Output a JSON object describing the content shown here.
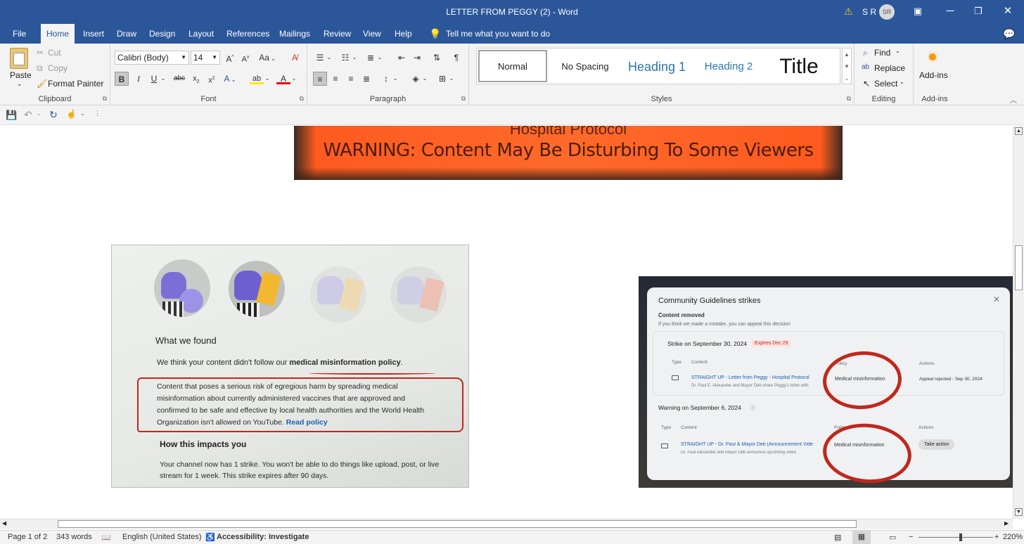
{
  "window": {
    "title": "LETTER FROM PEGGY (2)  -  Word",
    "user_initials": "S R",
    "avatar": "SR"
  },
  "menu": {
    "tabs": [
      "File",
      "Home",
      "Insert",
      "Draw",
      "Design",
      "Layout",
      "References",
      "Mailings",
      "Review",
      "View",
      "Help"
    ],
    "tell_me": "Tell me what you want to do"
  },
  "clipboard": {
    "paste": "Paste",
    "cut": "Cut",
    "copy": "Copy",
    "format_painter": "Format Painter",
    "label": "Clipboard"
  },
  "font": {
    "name": "Calibri (Body)",
    "size": "14",
    "label": "Font",
    "case_btn": "Aa"
  },
  "paragraph": {
    "label": "Paragraph"
  },
  "styles": {
    "items": [
      "Normal",
      "No Spacing",
      "Heading 1",
      "Heading 2",
      "Title"
    ],
    "label": "Styles"
  },
  "editing": {
    "find": "Find",
    "replace": "Replace",
    "select": "Select",
    "label": "Editing"
  },
  "addins": {
    "button": "Add-ins",
    "label": "Add-ins"
  },
  "doc": {
    "img1": {
      "line1": "Hospital Protocol",
      "line2": "WARNING: Content May Be Disturbing To Some Viewers"
    },
    "img2": {
      "heading": "What we found",
      "intro_a": "We think your content didn't follow our ",
      "intro_b": "medical misinformation policy",
      "intro_c": ".",
      "body": "Content that poses a serious risk of egregious harm by spreading medical misinformation about currently administered vaccines that are approved and confirmed to be safe and effective by local health authorities and the World Health Organization isn't allowed on YouTube.",
      "read_policy": "Read policy",
      "heading2": "How this impacts you",
      "impact": "Your channel now has 1 strike. You won't be able to do things like upload, post, or live stream for 1 week. This strike expires after 90 days."
    },
    "img3": {
      "title": "Community Guidelines strikes",
      "removed": "Content removed",
      "appeal_hint": "If you think we made a mistake, you can appeal this decision",
      "strike_title": "Strike on September 30, 2024",
      "expires": "Expires Dec 29",
      "col_type": "Type",
      "col_content": "Content",
      "col_policy": "Policy",
      "col_actions": "Actions",
      "row1_title": "STRAIGHT UP - Letter from Peggy - Hospital Protocol",
      "row1_sub": "Dr. Paul E. Alexander and Mayor Deb share Peggy's letter with",
      "row1_policy": "Medical misinformation",
      "row1_action": "Appeal rejected - Sep 30, 2024",
      "warning_title": "Warning on September 6, 2024",
      "row2_title": "STRAIGHT UP - Dr. Paul & Mayor Deb (Announcement Vide",
      "row2_sub": "Dr. Paul Alexander and Mayor Deb announce upcoming video",
      "row2_policy": "Medical misinformation",
      "row2_action": "Take action"
    }
  },
  "status": {
    "page": "Page 1 of 2",
    "words": "343 words",
    "language": "English (United States)",
    "accessibility": "Accessibility: Investigate",
    "zoom": "220%"
  }
}
